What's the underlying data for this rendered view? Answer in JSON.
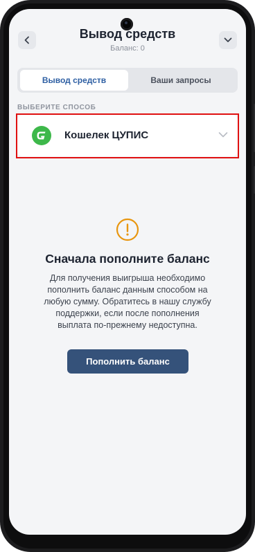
{
  "header": {
    "title": "Вывод средств",
    "balance_text": "Баланс: 0",
    "back_icon": "chevron-left-icon",
    "menu_icon": "chevron-down-icon"
  },
  "tabs": [
    {
      "label": "Вывод средств",
      "active": true
    },
    {
      "label": "Ваши запросы",
      "active": false
    }
  ],
  "method_section": {
    "label": "ВЫБЕРИТЕ СПОСОБ",
    "selected": {
      "name": "Кошелек ЦУПИС",
      "icon": "cupis-logo",
      "chevron_icon": "chevron-down-icon"
    }
  },
  "empty_state": {
    "icon": "warning-circle-icon",
    "title": "Сначала пополните баланс",
    "lines": [
      "Для получения выигрыша необходимо",
      "пополнить баланс данным способом на",
      "любую сумму. Обратитесь в нашу службу",
      "поддержки, если после пополнения",
      "выплата по-прежнему недоступна."
    ],
    "button_label": "Пополнить баланс"
  },
  "colors": {
    "accent_tab_text": "#2e5fa3",
    "button_bg": "#35527a",
    "warning_orange": "#e8960f",
    "logo_green": "#3db84a",
    "highlight_red": "#e01010"
  }
}
